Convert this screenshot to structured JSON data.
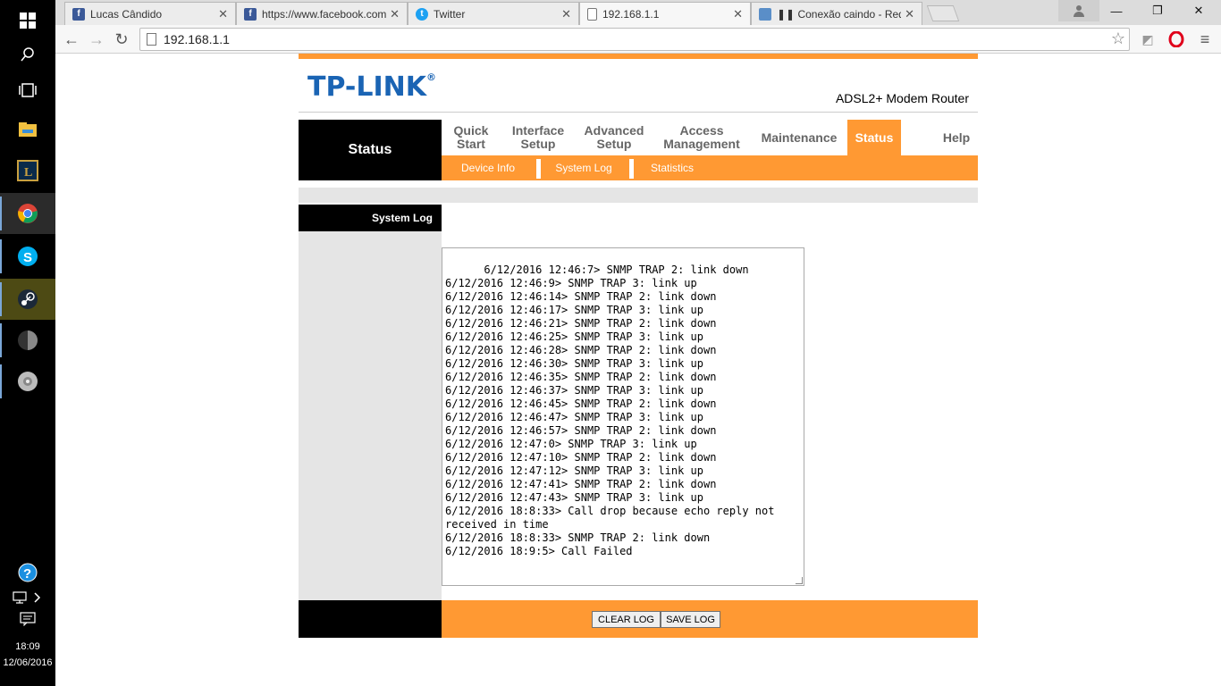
{
  "taskbar": {
    "clock_time": "18:09",
    "clock_date": "12/06/2016"
  },
  "browser": {
    "tabs": [
      {
        "title": "Lucas Cândido",
        "favicon": "facebook-icon"
      },
      {
        "title": "https://www.facebook.com",
        "favicon": "facebook-icon"
      },
      {
        "title": "Twitter",
        "favicon": "twitter-icon"
      },
      {
        "title": "192.168.1.1",
        "favicon": "page-icon"
      },
      {
        "title": "❚❚ Conexão caindo - Rede",
        "favicon": "forum-icon"
      }
    ],
    "url": "192.168.1.1"
  },
  "router": {
    "brand": "TP-LINK",
    "brand_mark": "®",
    "model": "ADSL2+ Modem Router",
    "section": "Status",
    "menu": [
      {
        "label": "Quick\nStart"
      },
      {
        "label": "Interface\nSetup"
      },
      {
        "label": "Advanced\nSetup"
      },
      {
        "label": "Access\nManagement"
      },
      {
        "label": "Maintenance"
      },
      {
        "label": "Status"
      },
      {
        "label": "Help"
      }
    ],
    "submenu": [
      "Device Info",
      "System Log",
      "Statistics"
    ],
    "side_title": "System Log",
    "log_text": "6/12/2016 12:46:7> SNMP TRAP 2: link down\n6/12/2016 12:46:9> SNMP TRAP 3: link up\n6/12/2016 12:46:14> SNMP TRAP 2: link down\n6/12/2016 12:46:17> SNMP TRAP 3: link up\n6/12/2016 12:46:21> SNMP TRAP 2: link down\n6/12/2016 12:46:25> SNMP TRAP 3: link up\n6/12/2016 12:46:28> SNMP TRAP 2: link down\n6/12/2016 12:46:30> SNMP TRAP 3: link up\n6/12/2016 12:46:35> SNMP TRAP 2: link down\n6/12/2016 12:46:37> SNMP TRAP 3: link up\n6/12/2016 12:46:45> SNMP TRAP 2: link down\n6/12/2016 12:46:47> SNMP TRAP 3: link up\n6/12/2016 12:46:57> SNMP TRAP 2: link down\n6/12/2016 12:47:0> SNMP TRAP 3: link up\n6/12/2016 12:47:10> SNMP TRAP 2: link down\n6/12/2016 12:47:12> SNMP TRAP 3: link up\n6/12/2016 12:47:41> SNMP TRAP 2: link down\n6/12/2016 12:47:43> SNMP TRAP 3: link up\n6/12/2016 18:8:33> Call drop because echo reply not received in time\n6/12/2016 18:8:33> SNMP TRAP 2: link down\n6/12/2016 18:9:5> Call Failed",
    "buttons": {
      "clear": "CLEAR LOG",
      "save": "SAVE LOG"
    }
  },
  "colors": {
    "accent": "#ff9933",
    "brand": "#1a64b4",
    "nav_dark": "#000000"
  }
}
